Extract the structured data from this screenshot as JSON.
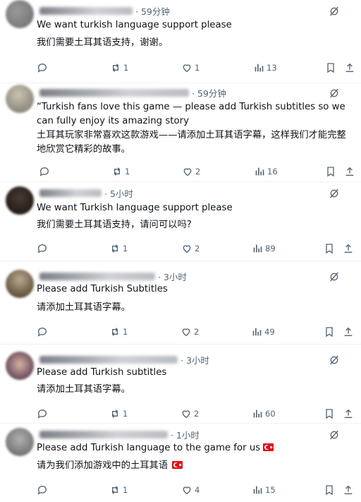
{
  "colors": {
    "icon": "#536471",
    "text": "#0f1419",
    "divider": "#eff3f4",
    "flag": "#e30a17"
  },
  "replies": [
    {
      "time": "· 59分钟",
      "text_en": "We want turkish language support please",
      "text_zh": "我们需要土耳其语支持，谢谢。",
      "retweets": "1",
      "likes": "1",
      "views": "13"
    },
    {
      "time": "· 59分钟",
      "text_en": "“Turkish fans love this game — please add Turkish subtitles so we can fully enjoy its amazing story",
      "text_zh": "土耳其玩家非常喜欢这款游戏——请添加土耳其语字幕，这样我们才能完整地欣赏它精彩的故事。",
      "retweets": "1",
      "likes": "2",
      "views": "16"
    },
    {
      "time": "· 5小时",
      "text_en": "We want Turkish language support please",
      "text_zh": "我们需要土耳其语支持，请问可以吗?",
      "retweets": "1",
      "likes": "2",
      "views": "89"
    },
    {
      "time": "· 3小时",
      "text_en": "Please add Turkish Subtitles",
      "text_zh": "请添加土耳其语字幕。",
      "retweets": "1",
      "likes": "2",
      "views": "49"
    },
    {
      "time": "· 3小时",
      "text_en": "Please add Turkish subtitles",
      "text_zh": "请添加土耳其语字幕。",
      "retweets": "1",
      "likes": "2",
      "views": "60"
    },
    {
      "time": "· 1小时",
      "text_en": "Please add Turkish language to the game for us",
      "text_zh": "请为我们添加游戏中的土耳其语",
      "retweets": "1",
      "likes": "4",
      "views": "15"
    }
  ]
}
